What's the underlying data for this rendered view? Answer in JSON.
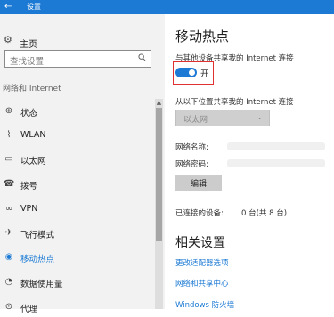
{
  "window": {
    "back": "←",
    "title": "设置"
  },
  "sidebar": {
    "home_label": "主页",
    "search_placeholder": "查找设置",
    "section_title": "网络和 Internet",
    "items": [
      {
        "label": "状态",
        "icon": "globe-icon"
      },
      {
        "label": "WLAN",
        "icon": "wifi-icon"
      },
      {
        "label": "以太网",
        "icon": "ethernet-icon"
      },
      {
        "label": "拨号",
        "icon": "dialup-icon"
      },
      {
        "label": "VPN",
        "icon": "vpn-icon"
      },
      {
        "label": "飞行模式",
        "icon": "airplane-icon"
      },
      {
        "label": "移动热点",
        "icon": "hotspot-icon",
        "active": true
      },
      {
        "label": "数据使用量",
        "icon": "data-usage-icon"
      },
      {
        "label": "代理",
        "icon": "proxy-icon"
      }
    ]
  },
  "main": {
    "title": "移动热点",
    "share_label": "与其他设备共享我的 Internet 连接",
    "toggle_state": "开",
    "share_from_label": "从以下位置共享我的 Internet 连接",
    "share_from_value": "以太网",
    "network_name_label": "网络名称:",
    "network_password_label": "网络密码:",
    "edit_button": "编辑",
    "connected_label": "已连接的设备:",
    "connected_value": "0 台(共 8 台)",
    "related_title": "相关设置",
    "links": [
      "更改适配器选项",
      "网络和共享中心",
      "Windows 防火墙"
    ]
  },
  "colors": {
    "accent": "#1c7ad4",
    "highlight_border": "#e03030"
  }
}
